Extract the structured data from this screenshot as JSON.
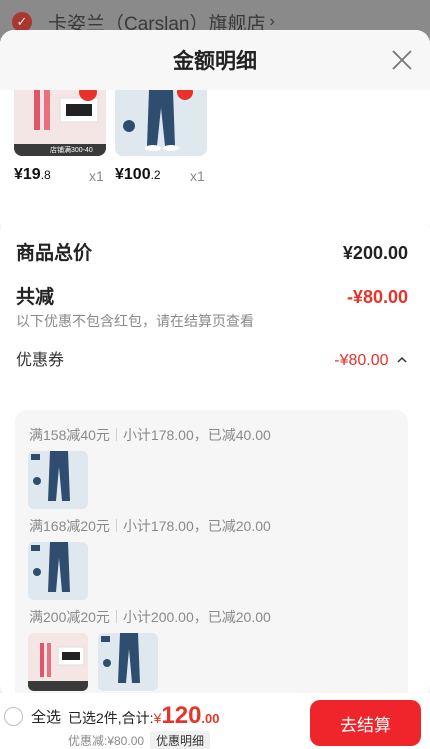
{
  "store": {
    "name": "卡姿兰（Carslan）旗舰店",
    "chevron": "›"
  },
  "sheet": {
    "title": "金额明细"
  },
  "products": [
    {
      "price_int": "¥19",
      "price_dec": ".8",
      "qty": "x1",
      "icon": "lipstick-product-image",
      "tag": "店铺满300-40"
    },
    {
      "price_int": "¥100",
      "price_dec": ".2",
      "qty": "x1",
      "icon": "jeans-product-image"
    }
  ],
  "summary": {
    "total_label": "商品总价",
    "total_value": "¥200.00",
    "discount_label": "共减",
    "discount_value": "-¥80.00",
    "discount_note": "以下优惠不包含红包，请在结算页查看"
  },
  "coupons": {
    "label": "优惠券",
    "value": "-¥80.00",
    "expand_icon": "chevron-up-icon",
    "rules": [
      {
        "rule": "满158减40元",
        "detail": "小计178.00，已减40.00"
      },
      {
        "rule": "满168减20元",
        "detail": "小计178.00，已减20.00"
      },
      {
        "rule": "满200减20元",
        "detail": "小计200.00，已减20.00"
      }
    ]
  },
  "bottom": {
    "select_all": "全选",
    "selected_text": "已选2件,合计:",
    "currency": "¥",
    "total_int": "120",
    "total_dec": ".00",
    "discount_text": "优惠减:¥80.00",
    "detail_chip": "优惠明细",
    "checkout": "去结算"
  },
  "colors": {
    "accent_red": "#e8322a",
    "button_red": "#f0242b"
  }
}
